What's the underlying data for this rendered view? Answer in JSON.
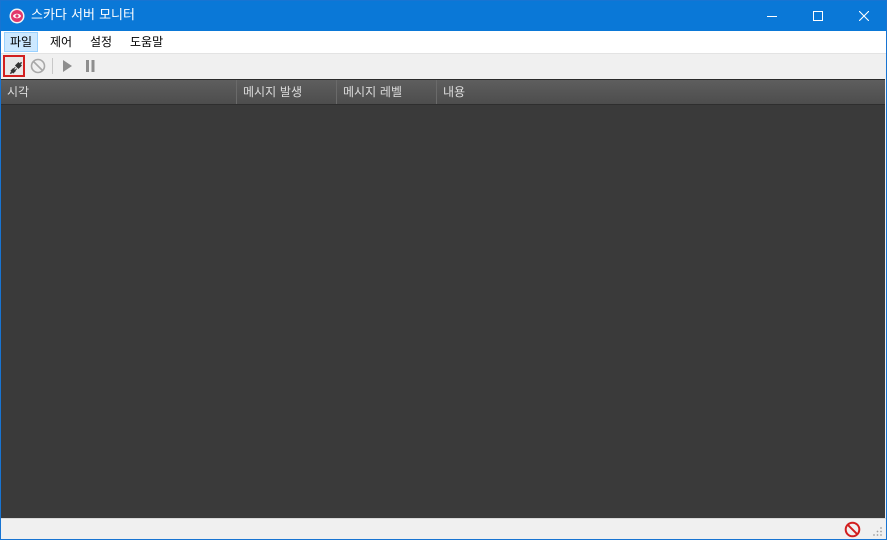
{
  "window": {
    "title": "스카다 서버 모니터",
    "accent_color": "#0a78d7"
  },
  "menu": {
    "items": [
      {
        "label": "파일",
        "active": true
      },
      {
        "label": "제어"
      },
      {
        "label": "설정"
      },
      {
        "label": "도움말"
      }
    ]
  },
  "toolbar": {
    "buttons": [
      {
        "icon": "plug-connect-icon",
        "selected": true
      },
      {
        "icon": "disconnect-prohibited-icon",
        "enabled": false
      },
      {
        "icon": "play-icon",
        "enabled": false
      },
      {
        "icon": "pause-icon",
        "enabled": false
      }
    ]
  },
  "grid": {
    "columns": [
      {
        "label": "시각"
      },
      {
        "label": "메시지 발생"
      },
      {
        "label": "메시지 레벨"
      },
      {
        "label": "내용"
      }
    ],
    "rows": [],
    "background_color": "#3a3a3a"
  },
  "statusbar": {
    "status_icon": "disconnected-prohibited-icon",
    "status_color": "#d21f1f"
  }
}
